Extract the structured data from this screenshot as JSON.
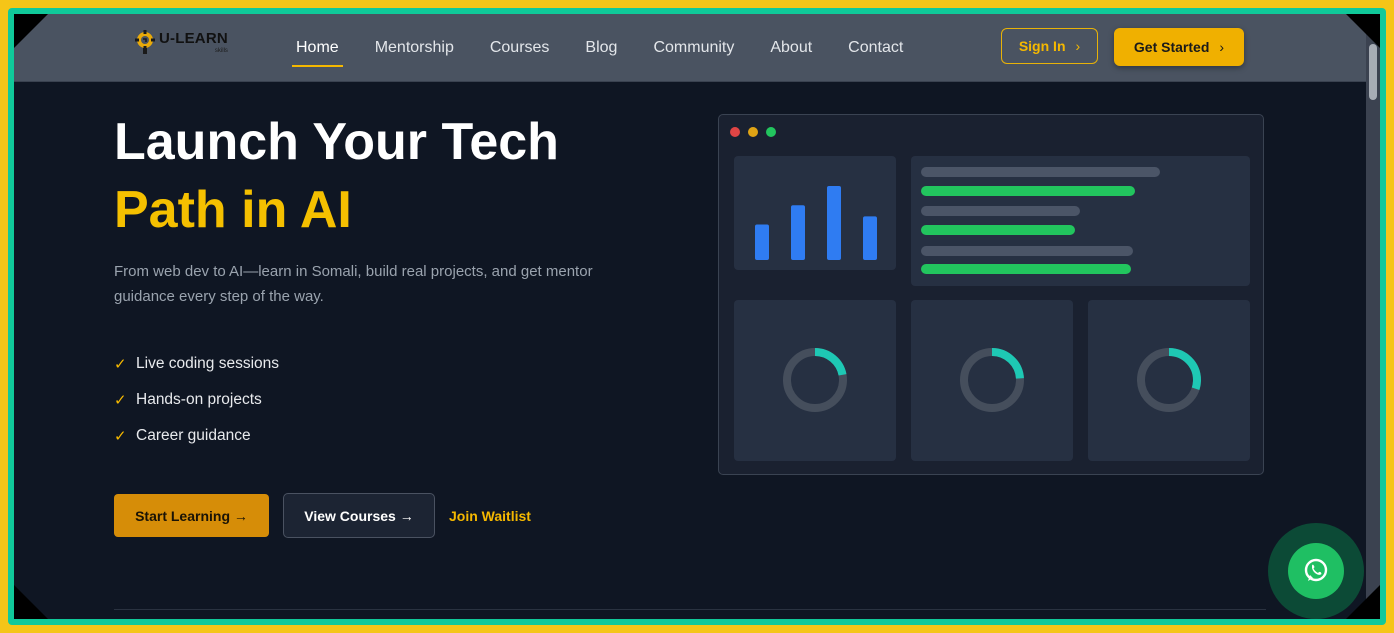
{
  "nav": {
    "logo_title": "U-LEARN",
    "logo_sub": "skills",
    "items": [
      {
        "label": "Home",
        "active": true
      },
      {
        "label": "Mentorship",
        "active": false
      },
      {
        "label": "Courses",
        "active": false
      },
      {
        "label": "Blog",
        "active": false
      },
      {
        "label": "Community",
        "active": false
      },
      {
        "label": "About",
        "active": false
      },
      {
        "label": "Contact",
        "active": false
      }
    ],
    "signin_label": "Sign In",
    "getstarted_label": "Get Started",
    "chevron_icon": "chevron-right-icon"
  },
  "hero": {
    "title_line1": "Launch Your Tech",
    "title_line2": "Path in AI",
    "description": "From web dev to AI—learn in Somali, build real projects, and get mentor guidance every step of the way.",
    "checks": [
      "Live coding sessions",
      "Hands-on projects",
      "Career guidance"
    ],
    "check_icon": "checkmark-icon",
    "start_label": "Start Learning →",
    "view_label": "View Courses →",
    "waitlist_label": "Join Waitlist"
  },
  "mockup": {
    "window_dot_colors": [
      "#e04545",
      "#e0a415",
      "#22c55e"
    ],
    "bar_levels": [
      0.48,
      0.74,
      1.0,
      0.59
    ],
    "bar_color": "#2f7cf2",
    "list_colors": {
      "muted": "#4b5567",
      "accent": "#22c55e"
    },
    "ring_progress": [
      0.22,
      0.24,
      0.3
    ],
    "ring_colors": {
      "track": "#454e5c",
      "accent": "#1ec8b4"
    }
  },
  "colors": {
    "accent": "#f5b800",
    "background": "#0f1623",
    "nav": "#4a5361"
  },
  "floating": {
    "whatsapp_icon": "whatsapp-icon"
  }
}
